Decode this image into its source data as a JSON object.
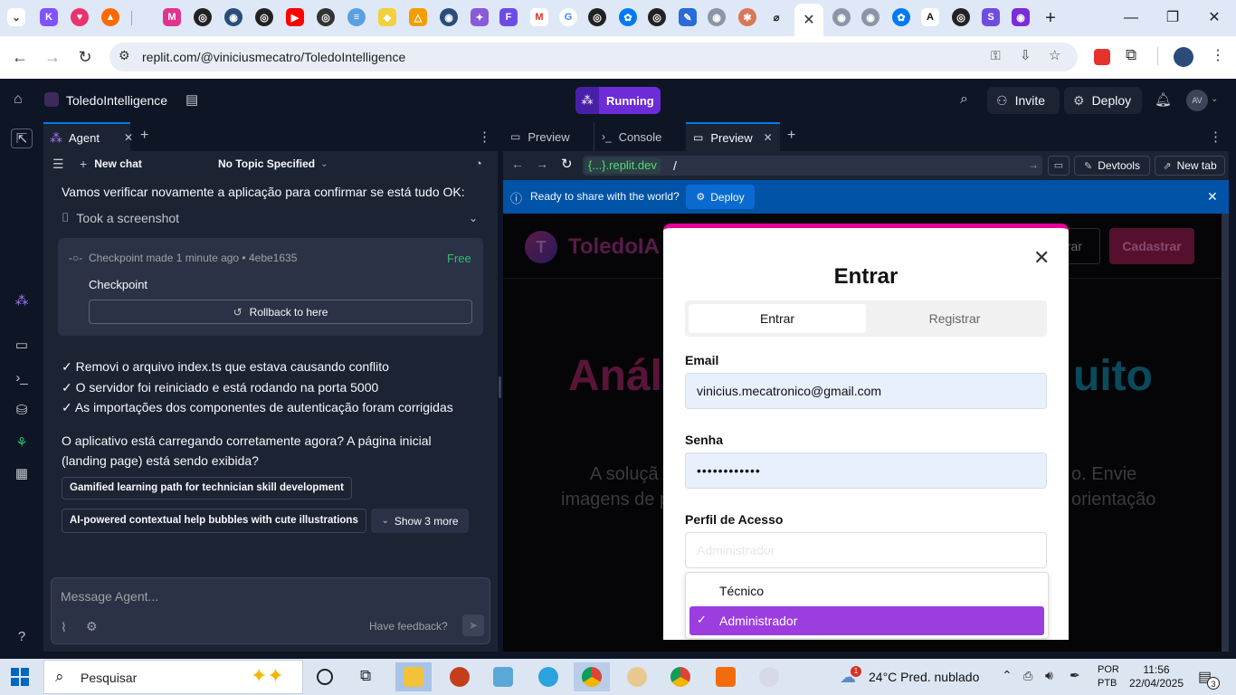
{
  "browser": {
    "url": "replit.com/@viniciusmecatro/ToledoIntelligence",
    "active_tab_close": "✕",
    "tab_icons": [
      "chevron-down-icon",
      "kotlin-icon",
      "heart-icon",
      "flame-icon",
      "blank-icon",
      "m-icon",
      "openai-icon",
      "globe-icon",
      "openai-icon",
      "youtube-icon",
      "openai-icon",
      "ai-icon",
      "files-icon",
      "drive-icon",
      "globe-icon",
      "sparkle-icon",
      "f-icon",
      "gmail-icon",
      "google-icon",
      "openai-icon",
      "replit-icon",
      "openai-icon",
      "pen-icon",
      "globe-icon",
      "claude-icon",
      "perplexity-icon",
      "active-tab",
      "globe-icon",
      "globe-icon",
      "replit-icon",
      "anthropic-icon",
      "openai-icon",
      "s-icon",
      "tv-icon"
    ]
  },
  "app": {
    "project_name": "ToledoIntelligence",
    "run_status": "Running",
    "invite_label": "Invite",
    "deploy_label": "Deploy",
    "avatar_initials": "AV"
  },
  "agent": {
    "tab_label": "Agent",
    "new_chat_label": "New chat",
    "topic_label": "No Topic Specified",
    "message_intro": "Vamos verificar novamente a aplicação para confirmar se está tudo OK:",
    "screenshot_label": "Took a screenshot",
    "checkpoint": {
      "meta": "Checkpoint made 1 minute ago • 4ebe1635",
      "price": "Free",
      "title": "Checkpoint",
      "rollback_label": "Rollback to here"
    },
    "checklist": [
      "✓ Removi o arquivo index.ts que estava causando conflito",
      "✓ O servidor foi reiniciado e está rodando na porta 5000",
      "✓ As importações dos componentes de autenticação foram corrigidas"
    ],
    "question": "O aplicativo está carregando corretamente agora? A página inicial (landing page) está sendo exibida?",
    "suggestions": [
      "Gamified learning path for technician skill development",
      "AI-powered contextual help bubbles with cute illustrations"
    ],
    "show_more_label": "Show 3 more",
    "input_placeholder": "Message Agent...",
    "feedback_label": "Have feedback?"
  },
  "preview": {
    "tabs": [
      {
        "label": "Preview"
      },
      {
        "label": "Console"
      },
      {
        "label": "Preview"
      }
    ],
    "domain_badge": "{...}.replit.dev",
    "path": "/",
    "devtools_label": "Devtools",
    "newtab_label": "New tab",
    "banner_text": "Ready to share with the world?",
    "banner_deploy": "Deploy"
  },
  "site": {
    "logo_letter": "T",
    "logo_text": "ToledoIA",
    "login_btn": "trar",
    "signup_btn": "Cadastrar",
    "hero_left": "Anál",
    "hero_right": "uito",
    "sub_left_1": "A soluçã",
    "sub_right_1": "o. Envie",
    "sub_left_2": "imagens de p",
    "sub_right_2": "orientação"
  },
  "modal": {
    "title": "Entrar",
    "tab_login": "Entrar",
    "tab_register": "Registrar",
    "email_label": "Email",
    "email_value": "vinicius.mecatronico@gmail.com",
    "password_label": "Senha",
    "password_value": "••••••••••••",
    "profile_label": "Perfil de Acesso",
    "profile_value": "Administrador",
    "options": [
      {
        "label": "Técnico",
        "selected": false
      },
      {
        "label": "Administrador",
        "selected": true
      }
    ],
    "accent": "#9b3ddf"
  },
  "taskbar": {
    "search_placeholder": "Pesquisar",
    "weather": "24°C  Pred. nublado",
    "weather_badge": "1",
    "lang_line1": "POR",
    "lang_line2": "PTB",
    "time": "11:56",
    "date": "22/04/2025",
    "notif_count": "3"
  }
}
